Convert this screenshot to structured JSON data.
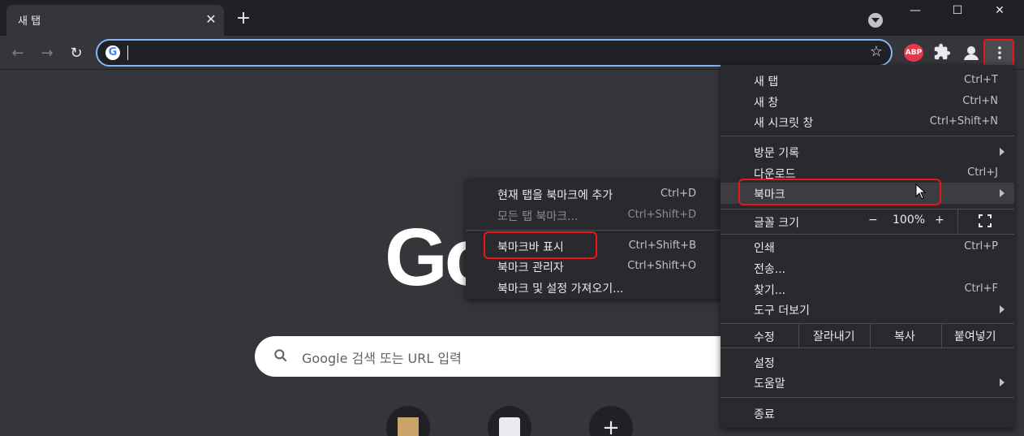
{
  "tab": {
    "title": "새 탭",
    "close": "✕",
    "new_tab": "+"
  },
  "window": {
    "minimize": "—",
    "maximize": "☐",
    "close": "✕"
  },
  "nav": {
    "back": "←",
    "forward": "→",
    "reload": "↻"
  },
  "omnibox": {
    "value": "",
    "star": "☆"
  },
  "extensions": {
    "abp": "ABP"
  },
  "page": {
    "logo": "Go",
    "search_placeholder": "Google 검색 또는 URL 입력",
    "shortcut_add": "+"
  },
  "bookmark_menu": {
    "items": [
      {
        "label": "현재 탭을 북마크에 추가",
        "shortcut": "Ctrl+D"
      },
      {
        "label": "모든 탭 북마크...",
        "shortcut": "Ctrl+Shift+D"
      },
      {
        "label": "북마크바 표시",
        "shortcut": "Ctrl+Shift+B"
      },
      {
        "label": "북마크 관리자",
        "shortcut": "Ctrl+Shift+O"
      },
      {
        "label": "북마크 및 설정 가져오기...",
        "shortcut": ""
      }
    ]
  },
  "main_menu": {
    "items": [
      {
        "label": "새 탭",
        "shortcut": "Ctrl+T"
      },
      {
        "label": "새 창",
        "shortcut": "Ctrl+N"
      },
      {
        "label": "새 시크릿 창",
        "shortcut": "Ctrl+Shift+N"
      },
      {
        "label": "방문 기록",
        "shortcut": ""
      },
      {
        "label": "다운로드",
        "shortcut": "Ctrl+J"
      },
      {
        "label": "북마크",
        "shortcut": ""
      },
      {
        "label": "인쇄",
        "shortcut": "Ctrl+P"
      },
      {
        "label": "전송...",
        "shortcut": ""
      },
      {
        "label": "찾기...",
        "shortcut": "Ctrl+F"
      },
      {
        "label": "도구 더보기",
        "shortcut": ""
      },
      {
        "label": "설정",
        "shortcut": ""
      },
      {
        "label": "도움말",
        "shortcut": ""
      },
      {
        "label": "종료",
        "shortcut": ""
      }
    ],
    "zoom": {
      "label": "글꼴 크기",
      "minus": "−",
      "value": "100%",
      "plus": "+"
    },
    "edit": {
      "label": "수정",
      "cut": "잘라내기",
      "copy": "복사",
      "paste": "붙여넣기"
    }
  },
  "colors": {
    "accent": "#8ab4f8",
    "highlight": "#e8171b",
    "menu_bg": "#292a2d",
    "page_bg": "#35363a"
  }
}
